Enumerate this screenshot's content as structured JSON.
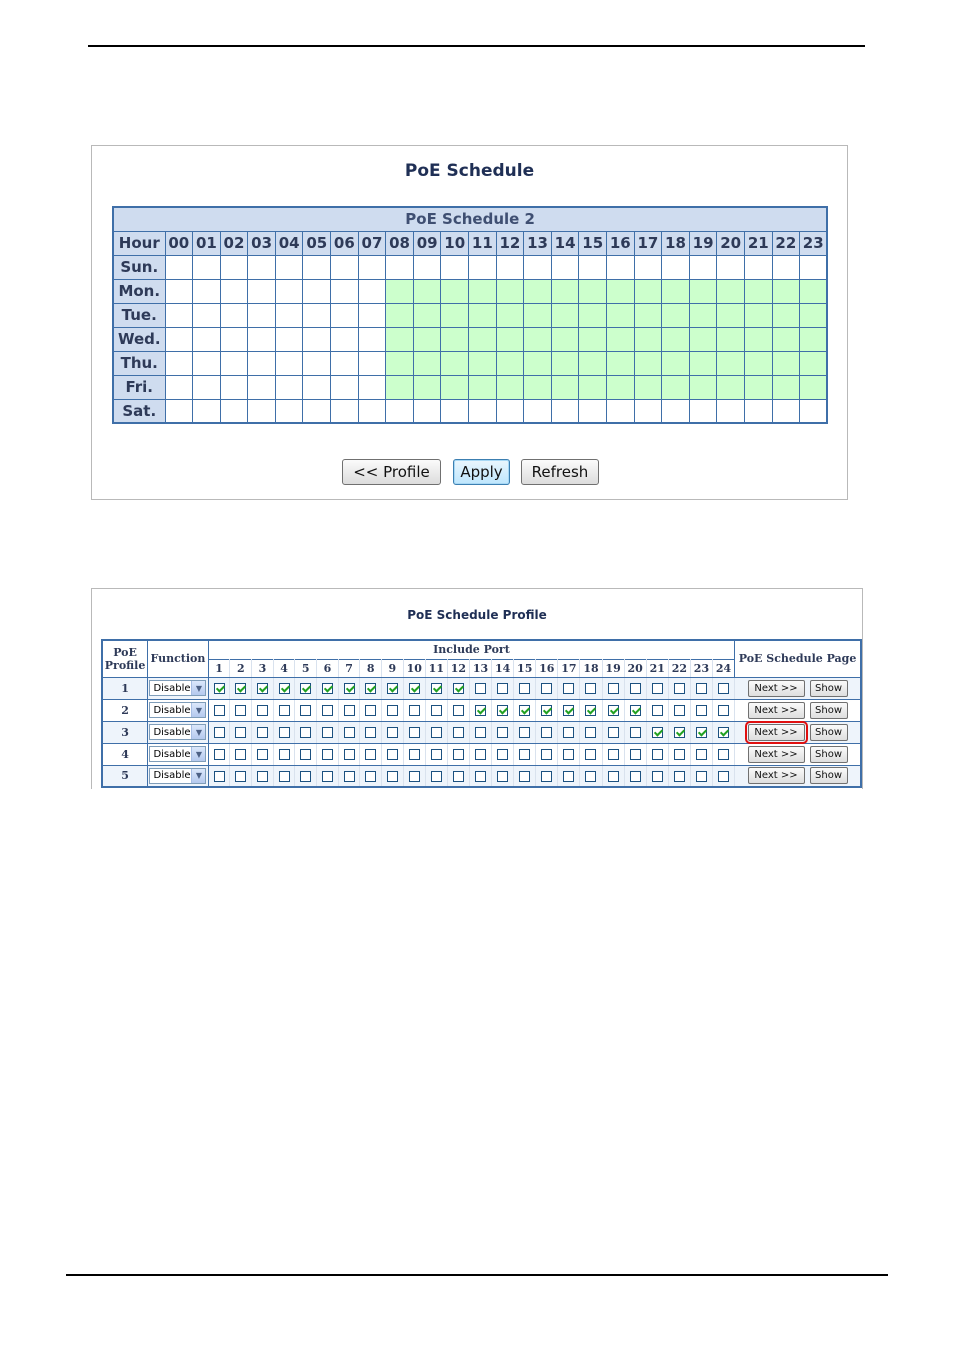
{
  "schedule_panel": {
    "title": "PoE Schedule",
    "table_caption": "PoE Schedule 2",
    "hour_label": "Hour",
    "hours": [
      "00",
      "01",
      "02",
      "03",
      "04",
      "05",
      "06",
      "07",
      "08",
      "09",
      "10",
      "11",
      "12",
      "13",
      "14",
      "15",
      "16",
      "17",
      "18",
      "19",
      "20",
      "21",
      "22",
      "23"
    ],
    "days": [
      {
        "label": "Sun.",
        "on": []
      },
      {
        "label": "Mon.",
        "on": [
          8,
          9,
          10,
          11,
          12,
          13,
          14,
          15,
          16,
          17,
          18,
          19,
          20,
          21,
          22,
          23
        ]
      },
      {
        "label": "Tue.",
        "on": [
          8,
          9,
          10,
          11,
          12,
          13,
          14,
          15,
          16,
          17,
          18,
          19,
          20,
          21,
          22,
          23
        ]
      },
      {
        "label": "Wed.",
        "on": [
          8,
          9,
          10,
          11,
          12,
          13,
          14,
          15,
          16,
          17,
          18,
          19,
          20,
          21,
          22,
          23
        ]
      },
      {
        "label": "Thu.",
        "on": [
          8,
          9,
          10,
          11,
          12,
          13,
          14,
          15,
          16,
          17,
          18,
          19,
          20,
          21,
          22,
          23
        ]
      },
      {
        "label": "Fri.",
        "on": [
          8,
          9,
          10,
          11,
          12,
          13,
          14,
          15,
          16,
          17,
          18,
          19,
          20,
          21,
          22,
          23
        ]
      },
      {
        "label": "Sat.",
        "on": []
      }
    ],
    "active_color": "#ccffcc",
    "buttons": {
      "profile": "<< Profile",
      "apply": "Apply",
      "refresh": "Refresh"
    }
  },
  "profile_panel": {
    "title": "PoE Schedule Profile",
    "headers": {
      "profile_line1": "PoE",
      "profile_line2": "Profile",
      "function": "Function",
      "include_port": "Include Port",
      "schedule_page": "PoE Schedule Page"
    },
    "ports": [
      "1",
      "2",
      "3",
      "4",
      "5",
      "6",
      "7",
      "8",
      "9",
      "10",
      "11",
      "12",
      "13",
      "14",
      "15",
      "16",
      "17",
      "18",
      "19",
      "20",
      "21",
      "22",
      "23",
      "24"
    ],
    "rows": [
      {
        "profile": "1",
        "function": "Disable",
        "checked": [
          1,
          2,
          3,
          4,
          5,
          6,
          7,
          8,
          9,
          10,
          11,
          12
        ],
        "next": "Next >>",
        "show": "Show"
      },
      {
        "profile": "2",
        "function": "Disable",
        "checked": [
          13,
          14,
          15,
          16,
          17,
          18,
          19,
          20
        ],
        "next": "Next >>",
        "show": "Show"
      },
      {
        "profile": "3",
        "function": "Disable",
        "checked": [
          21,
          22,
          23,
          24
        ],
        "next": "Next >>",
        "show": "Show",
        "highlight_next": true
      },
      {
        "profile": "4",
        "function": "Disable",
        "checked": [],
        "next": "Next >>",
        "show": "Show"
      },
      {
        "profile": "5",
        "function": "Disable",
        "checked": [],
        "next": "Next >>",
        "show": "Show"
      }
    ],
    "highlight_color": "#e01010"
  }
}
